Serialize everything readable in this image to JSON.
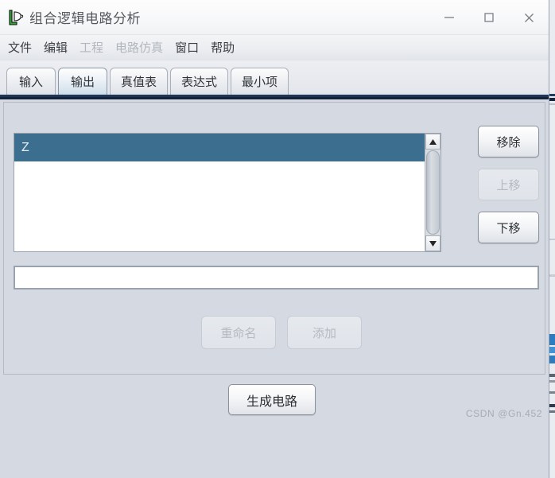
{
  "window": {
    "title": "组合逻辑电路分析",
    "icon": "logic-gate-icon",
    "controls": {
      "minimize": "minimize-icon",
      "maximize": "maximize-icon",
      "close": "close-icon"
    }
  },
  "menu": {
    "items": [
      {
        "label": "文件",
        "enabled": true
      },
      {
        "label": "编辑",
        "enabled": true
      },
      {
        "label": "工程",
        "enabled": false
      },
      {
        "label": "电路仿真",
        "enabled": false
      },
      {
        "label": "窗口",
        "enabled": true
      },
      {
        "label": "帮助",
        "enabled": true
      }
    ]
  },
  "tabs": {
    "selected_index": 1,
    "items": [
      {
        "label": "输入"
      },
      {
        "label": "输出"
      },
      {
        "label": "真值表"
      },
      {
        "label": "表达式"
      },
      {
        "label": "最小项"
      }
    ]
  },
  "list": {
    "items": [
      {
        "label": "Z",
        "selected": true
      }
    ],
    "scrollbar": {
      "up_icon": "scroll-up-arrow-icon",
      "down_icon": "scroll-down-arrow-icon"
    }
  },
  "side_buttons": {
    "remove": {
      "label": "移除",
      "enabled": true
    },
    "move_up": {
      "label": "上移",
      "enabled": false
    },
    "move_down": {
      "label": "下移",
      "enabled": true
    }
  },
  "name_field": {
    "value": "",
    "placeholder": ""
  },
  "center_buttons": {
    "rename": {
      "label": "重命名",
      "enabled": false
    },
    "add": {
      "label": "添加",
      "enabled": false
    }
  },
  "footer": {
    "generate": {
      "label": "生成电路",
      "enabled": true
    },
    "watermark": "CSDN @Gn.452"
  },
  "colors": {
    "selection": "#3b6e8f",
    "panel_bg": "#d4d9e2",
    "tab_underline": "#1d3557",
    "accent_blue": "#2b7cc1"
  }
}
